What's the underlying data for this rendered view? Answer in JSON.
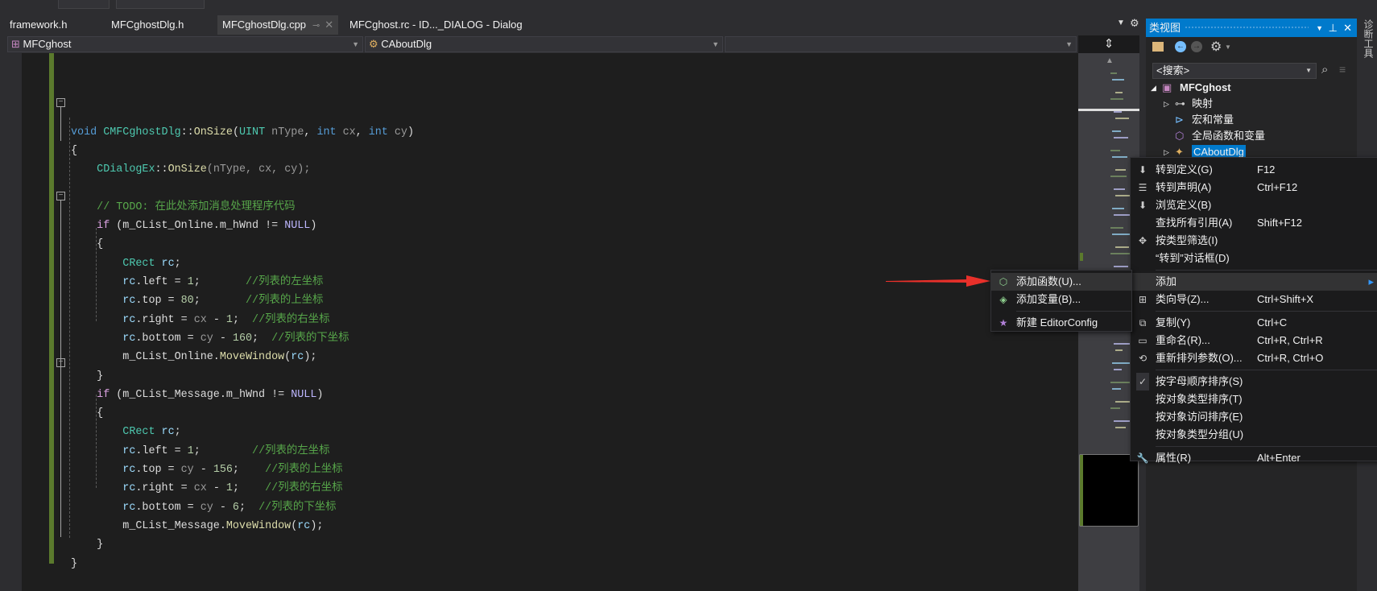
{
  "tabs": [
    {
      "label": "framework.h",
      "active": false
    },
    {
      "label": "MFCghostDlg.h",
      "active": false
    },
    {
      "label": "MFCghostDlg.cpp",
      "active": true
    },
    {
      "label": "MFCghost.rc - ID..._DIALOG - Dialog",
      "active": false
    }
  ],
  "tab_pin": "⊸",
  "tab_close": "✕",
  "navbar": {
    "project": "MFCghost",
    "class": "CAboutDlg",
    "member": ""
  },
  "code": [
    [],
    [],
    [
      [
        "void",
        "kw"
      ],
      [
        " ",
        "pl"
      ],
      [
        "CMFCghostDlg",
        "ty"
      ],
      [
        "::",
        "pl"
      ],
      [
        "OnSize",
        "fn"
      ],
      [
        "(",
        "pl"
      ],
      [
        "UINT",
        "ty"
      ],
      [
        " nType",
        "pa"
      ],
      [
        ", ",
        "pl"
      ],
      [
        "int",
        "kw"
      ],
      [
        " cx",
        "pa"
      ],
      [
        ", ",
        "pl"
      ],
      [
        "int",
        "kw"
      ],
      [
        " cy",
        "pa"
      ],
      [
        ")",
        "pl"
      ]
    ],
    [
      [
        "{",
        "pl"
      ]
    ],
    [
      [
        "    ",
        "pl"
      ],
      [
        "CDialogEx",
        "ty"
      ],
      [
        "::",
        "pl"
      ],
      [
        "OnSize",
        "fn"
      ],
      [
        "(nType, cx, cy);",
        "pa"
      ]
    ],
    [],
    [
      [
        "    ",
        "pl"
      ],
      [
        "// TODO: 在此处添加消息处理程序代码",
        "cm"
      ]
    ],
    [
      [
        "    ",
        "pl"
      ],
      [
        "if",
        "ctl"
      ],
      [
        " (m_CList_Online.m_hWnd != ",
        "pl"
      ],
      [
        "NULL",
        "mac"
      ],
      [
        ")",
        "pl"
      ]
    ],
    [
      [
        "    {",
        "pl"
      ]
    ],
    [
      [
        "        ",
        "pl"
      ],
      [
        "CRect",
        "ty"
      ],
      [
        " ",
        "pl"
      ],
      [
        "rc",
        "va"
      ],
      [
        ";",
        "pl"
      ]
    ],
    [
      [
        "        ",
        "pl"
      ],
      [
        "rc",
        "va"
      ],
      [
        ".left = ",
        "pl"
      ],
      [
        "1",
        "nu"
      ],
      [
        ";       ",
        "pl"
      ],
      [
        "//列表的左坐标",
        "cm"
      ]
    ],
    [
      [
        "        ",
        "pl"
      ],
      [
        "rc",
        "va"
      ],
      [
        ".top = ",
        "pl"
      ],
      [
        "80",
        "nu"
      ],
      [
        ";       ",
        "pl"
      ],
      [
        "//列表的上坐标",
        "cm"
      ]
    ],
    [
      [
        "        ",
        "pl"
      ],
      [
        "rc",
        "va"
      ],
      [
        ".right = ",
        "pl"
      ],
      [
        "cx",
        "pa"
      ],
      [
        " - ",
        "pl"
      ],
      [
        "1",
        "nu"
      ],
      [
        ";  ",
        "pl"
      ],
      [
        "//列表的右坐标",
        "cm"
      ]
    ],
    [
      [
        "        ",
        "pl"
      ],
      [
        "rc",
        "va"
      ],
      [
        ".bottom = ",
        "pl"
      ],
      [
        "cy",
        "pa"
      ],
      [
        " - ",
        "pl"
      ],
      [
        "160",
        "nu"
      ],
      [
        ";  ",
        "pl"
      ],
      [
        "//列表的下坐标",
        "cm"
      ]
    ],
    [
      [
        "        m_CList_Online.",
        "pl"
      ],
      [
        "MoveWindow",
        "fn"
      ],
      [
        "(",
        "pl"
      ],
      [
        "rc",
        "va"
      ],
      [
        ");",
        "pl"
      ]
    ],
    [
      [
        "    }",
        "pl"
      ]
    ],
    [
      [
        "    ",
        "pl"
      ],
      [
        "if",
        "ctl"
      ],
      [
        " (m_CList_Message.m_hWnd != ",
        "pl"
      ],
      [
        "NULL",
        "mac"
      ],
      [
        ")",
        "pl"
      ]
    ],
    [
      [
        "    {",
        "pl"
      ]
    ],
    [
      [
        "        ",
        "pl"
      ],
      [
        "CRect",
        "ty"
      ],
      [
        " ",
        "pl"
      ],
      [
        "rc",
        "va"
      ],
      [
        ";",
        "pl"
      ]
    ],
    [
      [
        "        ",
        "pl"
      ],
      [
        "rc",
        "va"
      ],
      [
        ".left = ",
        "pl"
      ],
      [
        "1",
        "nu"
      ],
      [
        ";        ",
        "pl"
      ],
      [
        "//列表的左坐标",
        "cm"
      ]
    ],
    [
      [
        "        ",
        "pl"
      ],
      [
        "rc",
        "va"
      ],
      [
        ".top = ",
        "pl"
      ],
      [
        "cy",
        "pa"
      ],
      [
        " - ",
        "pl"
      ],
      [
        "156",
        "nu"
      ],
      [
        ";    ",
        "pl"
      ],
      [
        "//列表的上坐标",
        "cm"
      ]
    ],
    [
      [
        "        ",
        "pl"
      ],
      [
        "rc",
        "va"
      ],
      [
        ".right = ",
        "pl"
      ],
      [
        "cx",
        "pa"
      ],
      [
        " - ",
        "pl"
      ],
      [
        "1",
        "nu"
      ],
      [
        ";    ",
        "pl"
      ],
      [
        "//列表的右坐标",
        "cm"
      ]
    ],
    [
      [
        "        ",
        "pl"
      ],
      [
        "rc",
        "va"
      ],
      [
        ".bottom = ",
        "pl"
      ],
      [
        "cy",
        "pa"
      ],
      [
        " - ",
        "pl"
      ],
      [
        "6",
        "nu"
      ],
      [
        ";  ",
        "pl"
      ],
      [
        "//列表的下坐标",
        "cm"
      ]
    ],
    [
      [
        "        m_CList_Message.",
        "pl"
      ],
      [
        "MoveWindow",
        "fn"
      ],
      [
        "(",
        "pl"
      ],
      [
        "rc",
        "va"
      ],
      [
        ");",
        "pl"
      ]
    ],
    [
      [
        "    }",
        "pl"
      ]
    ],
    [
      [
        "}",
        "pl"
      ]
    ]
  ],
  "classview": {
    "title": "类视图",
    "search_placeholder": "<搜索>",
    "tree": [
      {
        "label": "MFCghost",
        "expand": "◢",
        "icon": "project-icon",
        "bold": true,
        "level": 0
      },
      {
        "label": "映射",
        "expand": "▷",
        "icon": "key-icon",
        "level": 1
      },
      {
        "label": "宏和常量",
        "expand": "",
        "icon": "macro-icon",
        "level": 1
      },
      {
        "label": "全局函数和变量",
        "expand": "",
        "icon": "cube-icon",
        "level": 1
      },
      {
        "label": "CAboutDlg",
        "expand": "▷",
        "icon": "class-icon",
        "level": 1,
        "selected": true
      }
    ]
  },
  "context_menu": [
    {
      "label": "转到定义(G)",
      "shortcut": "F12",
      "icon": "go-to-definition-icon"
    },
    {
      "label": "转到声明(A)",
      "shortcut": "Ctrl+F12",
      "icon": "go-to-declaration-icon"
    },
    {
      "label": "浏览定义(B)",
      "shortcut": "",
      "icon": "peek-definition-icon"
    },
    {
      "label": "查找所有引用(A)",
      "shortcut": "Shift+F12",
      "icon": ""
    },
    {
      "label": "按类型筛选(I)",
      "shortcut": "",
      "icon": "filter-icon"
    },
    {
      "label": "“转到”对话框(D)",
      "shortcut": "",
      "icon": "",
      "sep_after": true
    },
    {
      "label": "添加",
      "shortcut": "",
      "icon": "",
      "submenu": true,
      "highlighted": true
    },
    {
      "label": "类向导(Z)...",
      "shortcut": "Ctrl+Shift+X",
      "icon": "class-wizard-icon",
      "sep_after": true
    },
    {
      "label": "复制(Y)",
      "shortcut": "Ctrl+C",
      "icon": "copy-icon"
    },
    {
      "label": "重命名(R)...",
      "shortcut": "Ctrl+R, Ctrl+R",
      "icon": "rename-icon"
    },
    {
      "label": "重新排列参数(O)...",
      "shortcut": "Ctrl+R, Ctrl+O",
      "icon": "reorder-icon",
      "sep_after": true
    },
    {
      "label": "按字母顺序排序(S)",
      "shortcut": "",
      "icon": "check-icon",
      "checked": true
    },
    {
      "label": "按对象类型排序(T)",
      "shortcut": "",
      "icon": ""
    },
    {
      "label": "按对象访问排序(E)",
      "shortcut": "",
      "icon": ""
    },
    {
      "label": "按对象类型分组(U)",
      "shortcut": "",
      "icon": "",
      "sep_after": true
    },
    {
      "label": "属性(R)",
      "shortcut": "Alt+Enter",
      "icon": "wrench-icon"
    }
  ],
  "submenu": [
    {
      "label": "添加函数(U)...",
      "icon": "add-function-icon",
      "highlighted": true
    },
    {
      "label": "添加变量(B)...",
      "icon": "add-variable-icon",
      "sep_after": true
    },
    {
      "label": "新建 EditorConfig",
      "icon": "editorconfig-file-icon"
    }
  ],
  "side_toolbar": "诊断工具",
  "colors": {
    "accent": "#007acc",
    "annotation_arrow": "#e8302a",
    "change_bar": "#5b7a2d"
  }
}
